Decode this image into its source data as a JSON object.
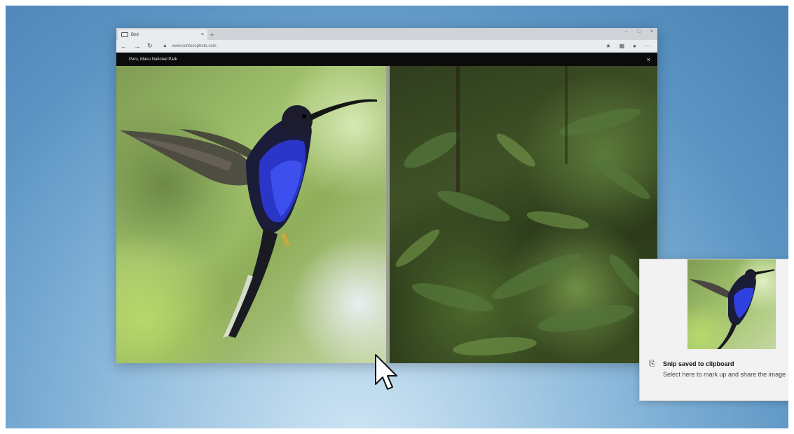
{
  "browser": {
    "tab_title": "Bird",
    "tab_close": "×",
    "new_tab": "+",
    "window_controls": {
      "minimize": "–",
      "maximize": "□",
      "close": "×"
    },
    "url": "www.contosophoto.com",
    "viewer_caption": "Peru, Manu National Park",
    "viewer_close": "×"
  },
  "toast": {
    "title": "Snip saved to clipboard",
    "body": "Select here to mark up and share the image"
  },
  "colors": {
    "wallpaper": "#5b94c3",
    "viewer_bar": "#0b0b0b",
    "toast_bg": "#f2f2f2"
  }
}
